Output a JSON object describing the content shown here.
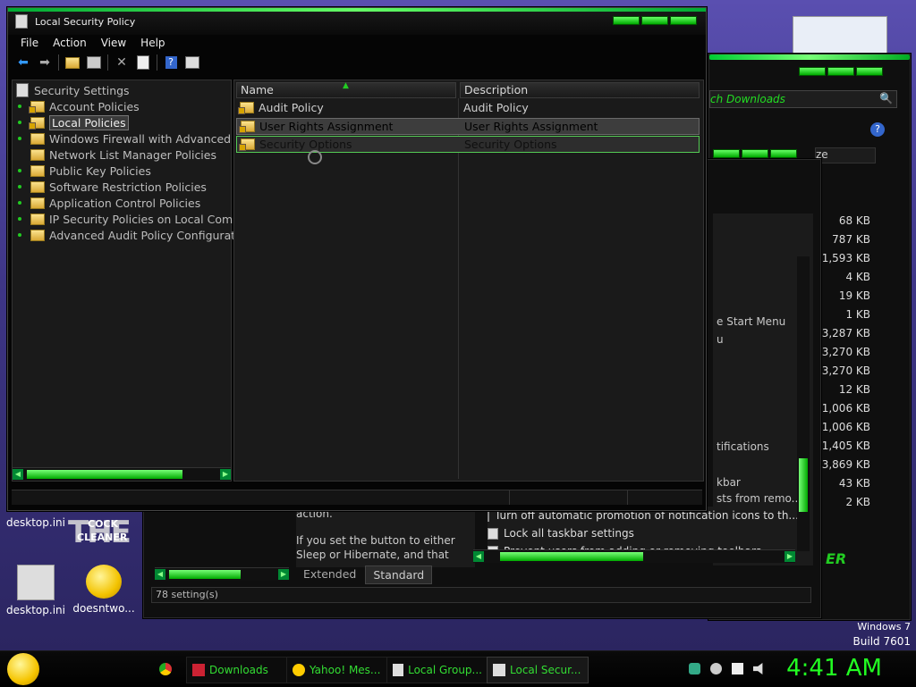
{
  "window": {
    "title": "Local Security Policy",
    "menu": [
      "File",
      "Action",
      "Help",
      "View"
    ],
    "menu_order": [
      "File",
      "Action",
      "View",
      "Help"
    ]
  },
  "toolbar": {
    "icons": [
      "back-arrow-icon",
      "forward-arrow-icon",
      "folder-up-icon",
      "console-tree-icon",
      "delete-icon",
      "export-list-icon",
      "help-icon",
      "properties-icon"
    ]
  },
  "tree": {
    "root": "Security Settings",
    "items": [
      "Account Policies",
      "Local Policies",
      "Windows Firewall with Advanced S",
      "Network List Manager Policies",
      "Public Key Policies",
      "Software Restriction Policies",
      "Application Control Policies",
      "IP Security Policies on Local Com",
      "Advanced Audit Policy Configuratio"
    ]
  },
  "list": {
    "columns": [
      "Name",
      "Description"
    ],
    "rows": [
      {
        "name": "Audit Policy",
        "description": "Audit Policy"
      },
      {
        "name": "User Rights Assignment",
        "description": "User Rights Assignment"
      },
      {
        "name": "Security Options",
        "description": "Security Options"
      }
    ]
  },
  "back_window": {
    "search_label": "ch Downloads",
    "column_label": "ze",
    "sizes": [
      "68 KB",
      "787 KB",
      "1,593 KB",
      "4 KB",
      "19 KB",
      "1 KB",
      "3,287 KB",
      "3,270 KB",
      "3,270 KB",
      "12 KB",
      "1,006 KB",
      "1,006 KB",
      "1,405 KB",
      "3,869 KB",
      "43 KB",
      "2 KB"
    ]
  },
  "gp_window": {
    "text_start_menu": "e Start Menu",
    "text_u": "u",
    "text_notifications": "tifications",
    "text_taskbar": "kbar",
    "text_remo": "sts from remo...",
    "action_text": "action.",
    "help_text_1": "If you set the button to either",
    "help_text_2": "Sleep or Hibernate, and that",
    "settings_items": [
      "Turn off automatic promotion of notification icons to th...",
      "Lock all taskbar settings",
      "Prevent users from adding or removing toolbars"
    ],
    "tabs": [
      "Extended",
      "Standard"
    ],
    "status": "78 setting(s)"
  },
  "desktop": {
    "icons": [
      {
        "label": "desktop.ini"
      },
      {
        "label": "desktop.ini"
      },
      {
        "label": "doesntwo..."
      }
    ],
    "cock_cleaner": [
      "COCK",
      "CLEANER"
    ],
    "the_text": "THE"
  },
  "os": {
    "line1": "Windows 7",
    "line2": "Build 7601"
  },
  "taskbar": {
    "buttons": [
      "Downloads",
      "Yahoo! Mes...",
      "Local Group...",
      "Local Secur..."
    ],
    "clock": "4:41 AM"
  },
  "colors": {
    "accent_green": "#22ee22",
    "window_bg": "#050505",
    "pane_bg": "#1a1a1a"
  }
}
